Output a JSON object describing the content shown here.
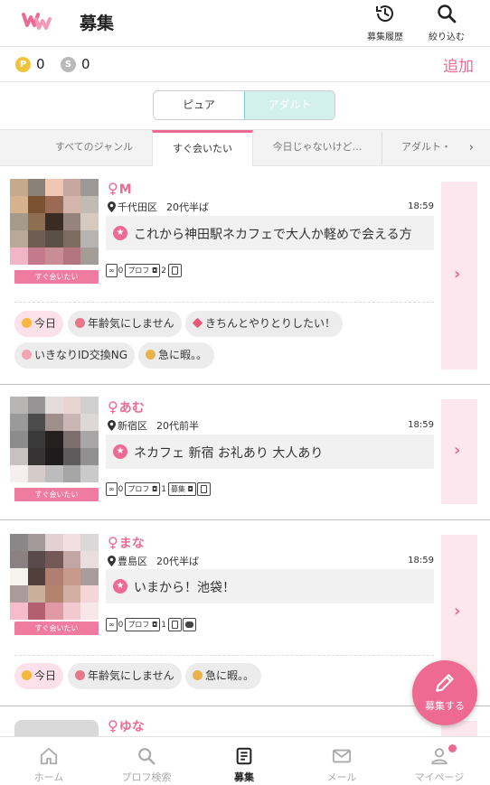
{
  "header": {
    "title": "募集",
    "history_label": "募集履歴",
    "filter_label": "絞り込む"
  },
  "points": {
    "p_coin": "P",
    "p_value": "0",
    "s_coin": "S",
    "s_value": "0",
    "add_label": "追加"
  },
  "mode_toggle": {
    "pure_label": "ピュア",
    "adult_label": "アダルト",
    "selected": "アダルト"
  },
  "genre_tabs": [
    {
      "label": "すべてのジャンル"
    },
    {
      "label": "すぐ会いたい"
    },
    {
      "label": "今日じゃないけど…"
    },
    {
      "label": "アダルト・"
    }
  ],
  "genre_tabs_more": "›",
  "posts": [
    {
      "gender": "♀",
      "name": "M",
      "area": "千代田区",
      "age": "20代半ば",
      "time": "18:59",
      "category": "すぐ会いたい",
      "message": "これから神田駅ネカフェで大人か軽めで会える方",
      "stats": {
        "views": "0",
        "prof_label": "プロフ",
        "prof_count": "2"
      },
      "tags": [
        "今日",
        "年齢気にしません",
        "きちんとやりとりしたい！",
        "いきなりID交換NG",
        "急に暇。。"
      ]
    },
    {
      "gender": "♀",
      "name": "あむ",
      "area": "新宿区",
      "age": "20代前半",
      "time": "18:59",
      "category": "すぐ会いたい",
      "message": "ネカフェ 新宿 お礼あり 大人あり",
      "stats": {
        "views": "0",
        "prof_label": "プロフ",
        "prof_count": "1",
        "boshu_label": "募集"
      },
      "tags": []
    },
    {
      "gender": "♀",
      "name": "まな",
      "area": "豊島区",
      "age": "20代半ば",
      "time": "18:59",
      "category": "すぐ会いたい",
      "message": "いまから！池袋！",
      "stats": {
        "views": "0",
        "prof_label": "プロフ",
        "prof_count": "1"
      },
      "tags": [
        "今日",
        "年齢気にしません",
        "急に暇。。"
      ]
    },
    {
      "gender": "♀",
      "name": "ゆな"
    }
  ],
  "fab_label": "募集する",
  "bottom_nav": [
    {
      "label": "ホーム"
    },
    {
      "label": "プロフ検索"
    },
    {
      "label": "募集"
    },
    {
      "label": "メール"
    },
    {
      "label": "マイページ"
    }
  ],
  "colors": {
    "accent": "#ef6a93",
    "adult_toggle": "#d3efee",
    "message_box": "#f1f1f1"
  }
}
